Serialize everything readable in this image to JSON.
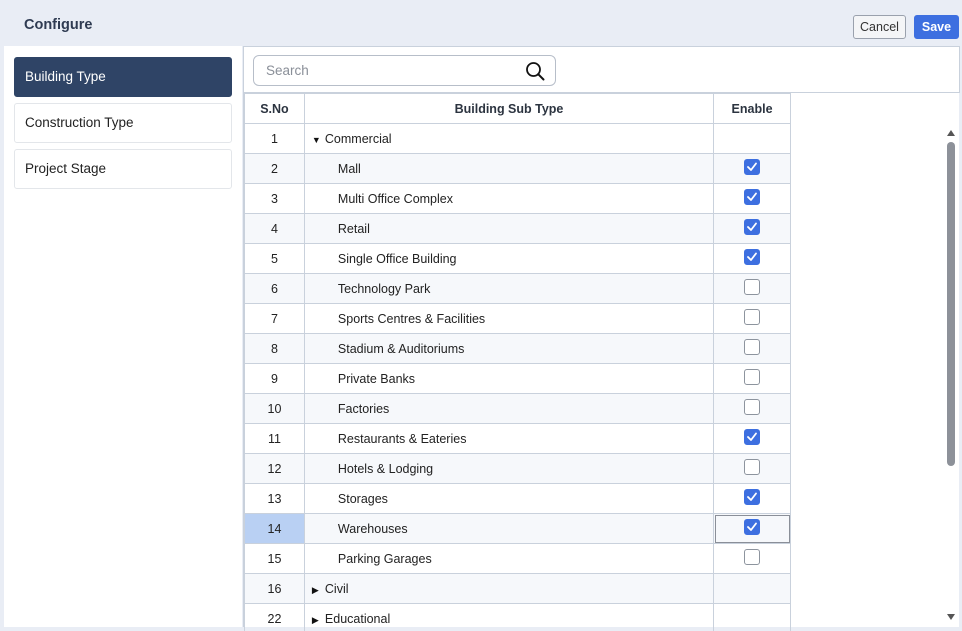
{
  "header": {
    "title": "Configure",
    "cancel_label": "Cancel",
    "save_label": "Save"
  },
  "sidebar": {
    "items": [
      {
        "label": "Building Type",
        "active": true
      },
      {
        "label": "Construction Type",
        "active": false
      },
      {
        "label": "Project Stage",
        "active": false
      }
    ]
  },
  "search": {
    "placeholder": "Search",
    "value": ""
  },
  "table": {
    "headers": {
      "sno": "S.No",
      "sub_type": "Building Sub Type",
      "enable": "Enable"
    },
    "rows": [
      {
        "sno": "1",
        "label": "Commercial",
        "kind": "group",
        "expanded": true
      },
      {
        "sno": "2",
        "label": "Mall",
        "kind": "item",
        "enabled": true
      },
      {
        "sno": "3",
        "label": "Multi Office Complex",
        "kind": "item",
        "enabled": true
      },
      {
        "sno": "4",
        "label": "Retail",
        "kind": "item",
        "enabled": true
      },
      {
        "sno": "5",
        "label": "Single Office Building",
        "kind": "item",
        "enabled": true
      },
      {
        "sno": "6",
        "label": "Technology Park",
        "kind": "item",
        "enabled": false
      },
      {
        "sno": "7",
        "label": "Sports Centres & Facilities",
        "kind": "item",
        "enabled": false
      },
      {
        "sno": "8",
        "label": "Stadium & Auditoriums",
        "kind": "item",
        "enabled": false
      },
      {
        "sno": "9",
        "label": "Private Banks",
        "kind": "item",
        "enabled": false
      },
      {
        "sno": "10",
        "label": "Factories",
        "kind": "item",
        "enabled": false
      },
      {
        "sno": "11",
        "label": "Restaurants & Eateries",
        "kind": "item",
        "enabled": true
      },
      {
        "sno": "12",
        "label": "Hotels & Lodging",
        "kind": "item",
        "enabled": false
      },
      {
        "sno": "13",
        "label": "Storages",
        "kind": "item",
        "enabled": true
      },
      {
        "sno": "14",
        "label": "Warehouses",
        "kind": "item",
        "enabled": true,
        "selected": true
      },
      {
        "sno": "15",
        "label": "Parking Garages",
        "kind": "item",
        "enabled": false
      },
      {
        "sno": "16",
        "label": "Civil",
        "kind": "group",
        "expanded": false
      },
      {
        "sno": "22",
        "label": "Educational",
        "kind": "group",
        "expanded": false
      }
    ]
  },
  "colors": {
    "accent": "#3d6fe0",
    "sidebar_active": "#2f4466",
    "row_selected": "#b9d0f3"
  },
  "icons": {
    "search": "search-icon",
    "expanded": "caret-down-icon",
    "collapsed": "caret-right-icon",
    "checked": "check-icon"
  }
}
